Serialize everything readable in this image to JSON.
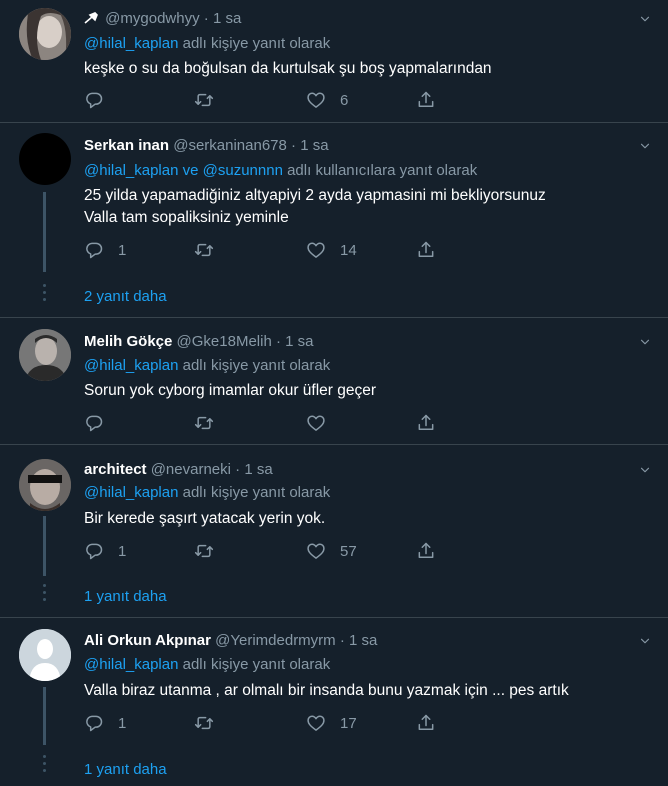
{
  "tweets": [
    {
      "name": "",
      "handle": "@mygodwhyy",
      "time": "1 sa",
      "reply_mention": "@hilal_kaplan",
      "reply_suffix": " adlı kişiye yanıt olarak",
      "text": [
        "keşke o su da boğulsan da kurtulsak şu boş yapmalarından"
      ],
      "replies": "",
      "likes": "6"
    },
    {
      "name": "Serkan inan",
      "handle": "@serkaninan678",
      "time": "1 sa",
      "reply_mention": "@hilal_kaplan ve @suzunnnn",
      "reply_suffix": " adlı kullanıcılara yanıt olarak",
      "text": [
        "25 yilda yapamadiğiniz altyapiyi 2 ayda yapmasini mi bekliyorsunuz",
        "Valla tam sopaliksiniz yeminle"
      ],
      "replies": "1",
      "likes": "14",
      "more": "2 yanıt daha"
    },
    {
      "name": "Melih Gökçe",
      "handle": "@Gke18Melih",
      "time": "1 sa",
      "reply_mention": "@hilal_kaplan",
      "reply_suffix": " adlı kişiye yanıt olarak",
      "text": [
        "Sorun yok cyborg imamlar okur üfler geçer"
      ],
      "replies": "",
      "likes": ""
    },
    {
      "name": "architect",
      "handle": "@nevarneki",
      "time": "1 sa",
      "reply_mention": "@hilal_kaplan",
      "reply_suffix": " adlı kişiye yanıt olarak",
      "text": [
        "Bir kerede şaşırt yatacak yerin yok."
      ],
      "replies": "1",
      "likes": "57",
      "more": "1 yanıt daha"
    },
    {
      "name": "Ali Orkun Akpınar",
      "handle": "@Yerimdedrmyrm",
      "time": "1 sa",
      "reply_mention": "@hilal_kaplan",
      "reply_suffix": " adlı kişiye yanıt olarak",
      "text": [
        "Valla biraz utanma , ar olmalı bir insanda bunu yazmak için ... pes artık"
      ],
      "replies": "1",
      "likes": "17",
      "more": "1 yanıt daha"
    }
  ],
  "separator": "·",
  "colors": {
    "background": "#15202b",
    "border": "#38444d",
    "muted": "#8899a6",
    "accent": "#1da1f2"
  },
  "icons": [
    "chevron-down-icon",
    "reply-icon",
    "retweet-icon",
    "like-icon",
    "share-icon",
    "pin-icon",
    "more-dots-icon"
  ]
}
